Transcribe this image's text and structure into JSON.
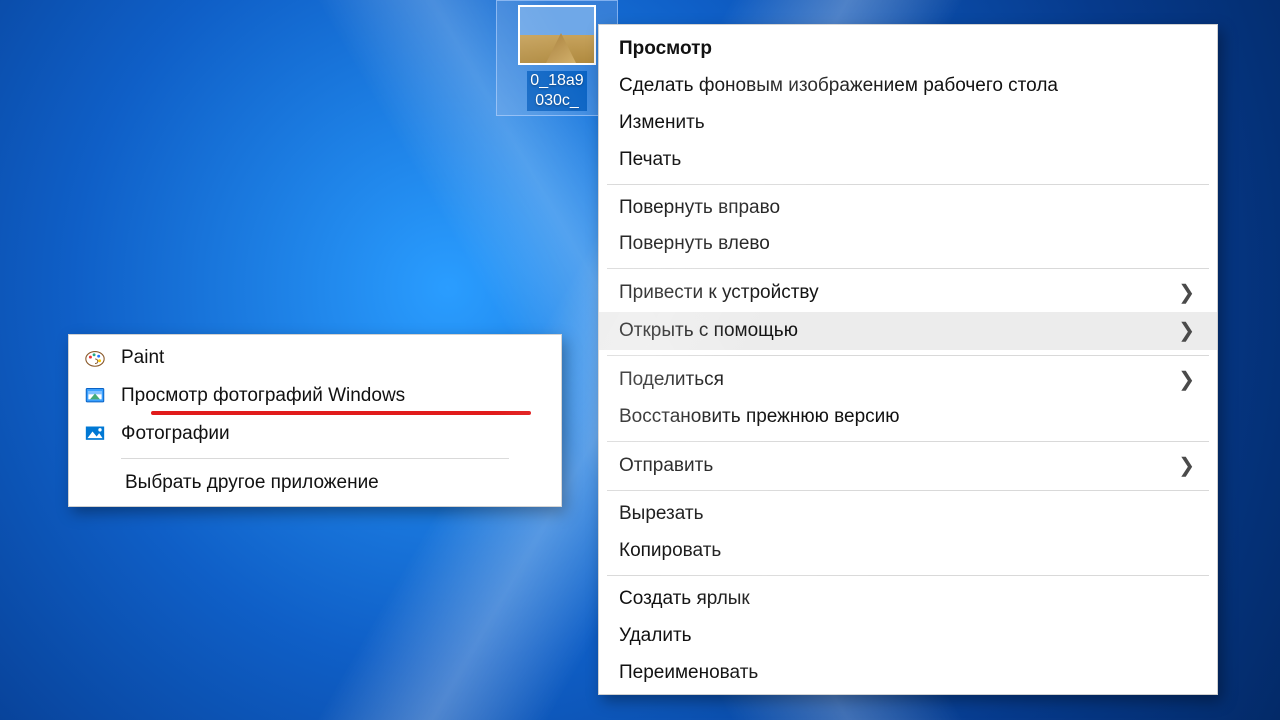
{
  "desktop": {
    "file_caption": "0_18a9\n030c_"
  },
  "context_menu": {
    "items": [
      {
        "label": "Просмотр",
        "bold": true,
        "arrow": false,
        "hover": false,
        "sep_after": false
      },
      {
        "label": "Сделать фоновым изображением рабочего стола",
        "bold": false,
        "arrow": false,
        "hover": false,
        "sep_after": false
      },
      {
        "label": "Изменить",
        "bold": false,
        "arrow": false,
        "hover": false,
        "sep_after": false
      },
      {
        "label": "Печать",
        "bold": false,
        "arrow": false,
        "hover": false,
        "sep_after": true
      },
      {
        "label": "Повернуть вправо",
        "bold": false,
        "arrow": false,
        "hover": false,
        "sep_after": false
      },
      {
        "label": "Повернуть влево",
        "bold": false,
        "arrow": false,
        "hover": false,
        "sep_after": true
      },
      {
        "label": "Привести к устройству",
        "bold": false,
        "arrow": true,
        "hover": false,
        "sep_after": false
      },
      {
        "label": "Открыть с помощью",
        "bold": false,
        "arrow": true,
        "hover": true,
        "sep_after": true
      },
      {
        "label": "Поделиться",
        "bold": false,
        "arrow": true,
        "hover": false,
        "sep_after": false
      },
      {
        "label": "Восстановить прежнюю версию",
        "bold": false,
        "arrow": false,
        "hover": false,
        "sep_after": true
      },
      {
        "label": "Отправить",
        "bold": false,
        "arrow": true,
        "hover": false,
        "sep_after": true
      },
      {
        "label": "Вырезать",
        "bold": false,
        "arrow": false,
        "hover": false,
        "sep_after": false
      },
      {
        "label": "Копировать",
        "bold": false,
        "arrow": false,
        "hover": false,
        "sep_after": true
      },
      {
        "label": "Создать ярлык",
        "bold": false,
        "arrow": false,
        "hover": false,
        "sep_after": false
      },
      {
        "label": "Удалить",
        "bold": false,
        "arrow": false,
        "hover": false,
        "sep_after": false
      },
      {
        "label": "Переименовать",
        "bold": false,
        "arrow": false,
        "hover": false,
        "sep_after": false
      }
    ]
  },
  "sub_menu": {
    "items": [
      {
        "label": "Paint",
        "icon": "paint"
      },
      {
        "label": "Просмотр фотографий Windows",
        "icon": "photo-viewer",
        "underline": true
      },
      {
        "label": "Фотографии",
        "icon": "photos"
      }
    ],
    "choose_other": "Выбрать другое приложение"
  }
}
